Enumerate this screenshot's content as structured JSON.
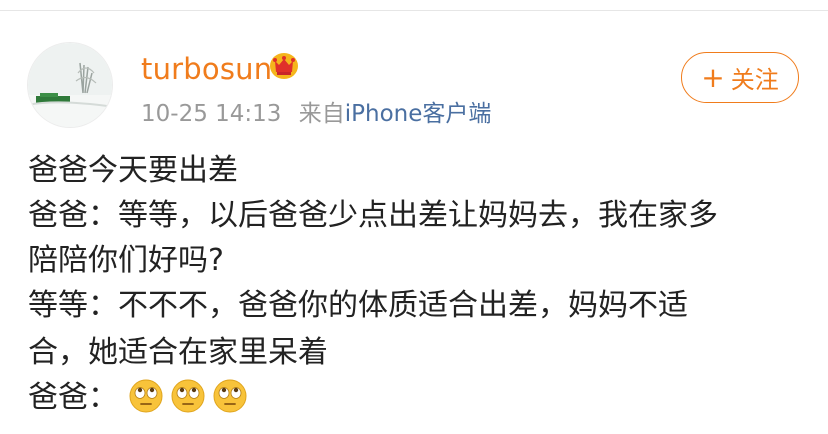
{
  "user": {
    "name": "turbosun",
    "timestamp": "10-25 14:13",
    "source_prefix": "来自",
    "device": "iPhone客户端"
  },
  "follow_button": {
    "icon": "plus-icon",
    "label": "关注"
  },
  "post": {
    "lines": [
      "爸爸今天要出差",
      "爸爸：等等，以后爸爸少点出差让妈妈去，我在家多",
      "陪陪你们好吗?",
      "等等：不不不，爸爸你的体质适合出差，妈妈不适",
      "合，她适合在家里呆着",
      "爸爸："
    ],
    "trailing_emojis": [
      "eye-roll-emoji",
      "eye-roll-emoji",
      "eye-roll-emoji"
    ]
  },
  "colors": {
    "accent": "#f07c1c",
    "link": "#4a6fa1",
    "meta": "#999999",
    "text": "#222222"
  }
}
